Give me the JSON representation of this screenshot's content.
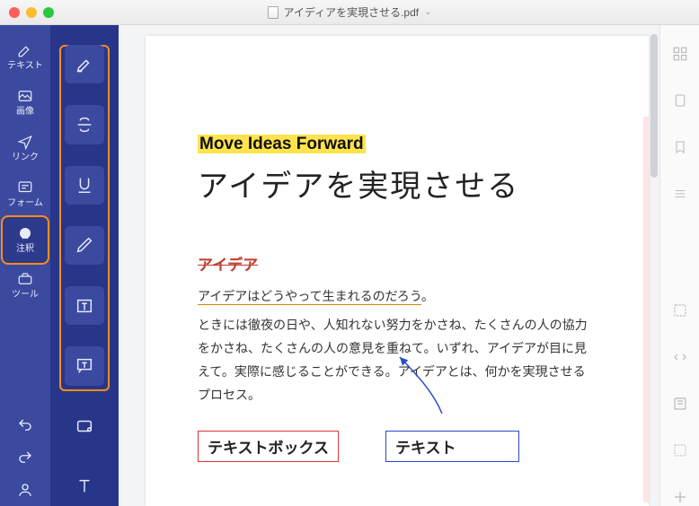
{
  "window": {
    "title": "アイディアを実現させる.pdf"
  },
  "primary_sidebar": {
    "items": [
      {
        "id": "text",
        "label": "テキスト"
      },
      {
        "id": "image",
        "label": "画像"
      },
      {
        "id": "link",
        "label": "リンク"
      },
      {
        "id": "form",
        "label": "フォーム"
      },
      {
        "id": "annot",
        "label": "注釈",
        "selected": true
      },
      {
        "id": "tool",
        "label": "ツール"
      }
    ]
  },
  "annotation_tools": [
    "highlight",
    "strikethrough",
    "underline",
    "pencil",
    "text-box",
    "text-callout",
    "area-highlight",
    "text-insert"
  ],
  "document": {
    "highlight_title": "Move Ideas Forward",
    "jp_title": "アイデアを実現させる",
    "strike_word": "アイデア",
    "underline_sentence": "アイデアはどうやって生まれるのだろう",
    "underline_tail": "。",
    "paragraph": "ときには徹夜の日や、人知れない努力をかさね、たくさんの人の協力をかさね、たくさんの人の意見を重ねて。いずれ、アイデアが目に見えて。実際に感じることができる。アイデアとは、何かを実現させるプロセス。",
    "textbox_label": "テキストボックス",
    "text_label": "テキスト"
  },
  "right_panel_icons": [
    "thumbnails",
    "page",
    "bookmark",
    "outline"
  ],
  "right_panel_lower": [
    "search",
    "code",
    "properties",
    "crop",
    "add"
  ]
}
